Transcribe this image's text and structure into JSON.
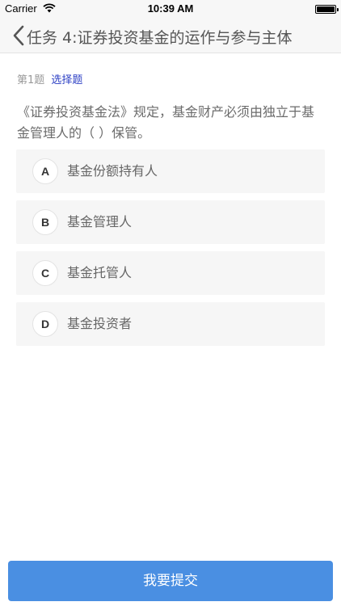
{
  "status_bar": {
    "carrier": "Carrier",
    "time": "10:39 AM"
  },
  "nav": {
    "title": "任务 4:证券投资基金的运作与参与主体",
    "back_icon": "chevron-left-icon"
  },
  "question": {
    "number": "第1题",
    "type": "选择题",
    "text": "《证券投资基金法》规定，基金财产必须由独立于基金管理人的（ ）保管。",
    "options": [
      {
        "letter": "A",
        "text": "基金份额持有人"
      },
      {
        "letter": "B",
        "text": "基金管理人"
      },
      {
        "letter": "C",
        "text": "基金托管人"
      },
      {
        "letter": "D",
        "text": "基金投资者"
      }
    ]
  },
  "submit": {
    "label": "我要提交"
  },
  "colors": {
    "accent": "#4a8fe2",
    "type_link": "#2c3fc4",
    "option_bg": "#f6f6f6"
  }
}
